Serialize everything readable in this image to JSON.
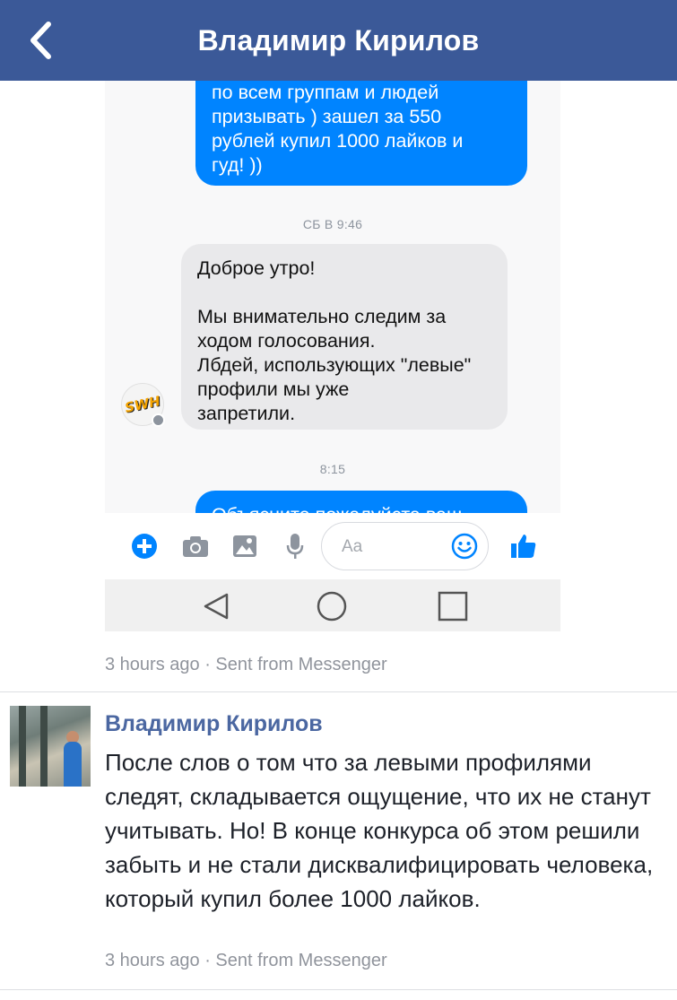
{
  "header": {
    "title": "Владимир Кирилов",
    "back_icon": "chevron-left-icon",
    "background_color": "#3b5998"
  },
  "screenshot": {
    "messages": {
      "outgoing_top": {
        "lines": [
          "по всем группам и людей",
          "призывать ) зашел за 550",
          "рублей купил 1000 лайков и",
          "гуд! ))"
        ],
        "color": "#0084ff"
      },
      "stamp_1": "СБ В 9:46",
      "incoming": {
        "line_1": "Доброе утро!",
        "line_2": "Мы внимательно следим за",
        "line_3": "ходом голосования.",
        "line_4": "Лбдей, использующих \"левые\"",
        "line_5": "профили мы уже",
        "line_6": "запретили."
      },
      "sender_avatar_logo": "SWH",
      "stamp_2": "8:15",
      "outgoing_bottom": {
        "text": "Объясните пожалуйста ваш"
      }
    },
    "composer": {
      "placeholder": "Aa",
      "icons": [
        "plus-icon",
        "camera-icon",
        "image-icon",
        "microphone-icon",
        "emoji-icon",
        "thumbs-up-icon"
      ]
    },
    "navbar": {
      "icons": [
        "back-triangle-icon",
        "home-circle-icon",
        "recents-square-icon"
      ]
    }
  },
  "post_meta": {
    "text": "3 hours ago · Sent from Messenger"
  },
  "comment": {
    "author": "Владимир Кирилов",
    "text": "После слов о том что за левыми профилями следят, складывается ощущение, что их не станут учитывать. Но! В конце конкурса об этом решили забыть и не стали дисквалифицировать человека, который купил более 1000 лайков.",
    "meta": "3 hours ago · Sent from Messenger"
  }
}
